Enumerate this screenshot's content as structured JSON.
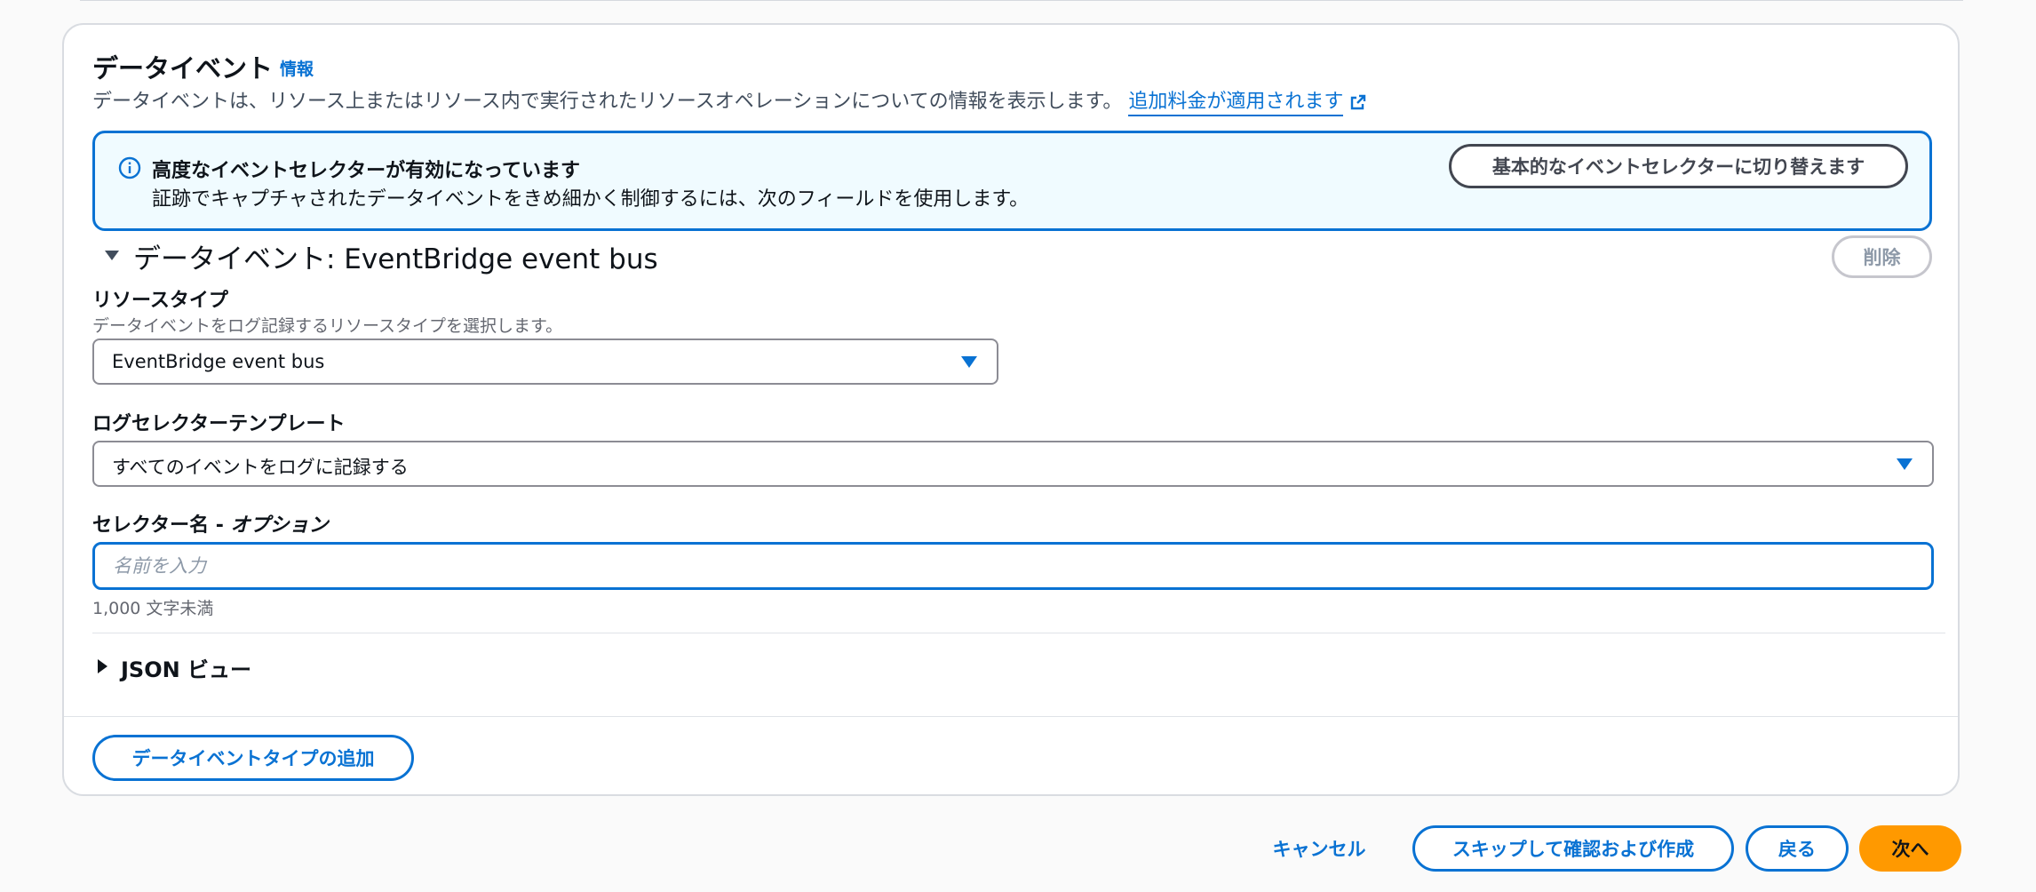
{
  "header": {
    "title": "データイベント",
    "info": "情報",
    "description": "データイベントは、リソース上またはリソース内で実行されたリソースオペレーションについての情報を表示します。",
    "link": "追加料金が適用されます"
  },
  "alert": {
    "title": "高度なイベントセレクターが有効になっています",
    "body": "証跡でキャプチャされたデータイベントをきめ細かく制御するには、次のフィールドを使用します。",
    "button": "基本的なイベントセレクターに切り替えます"
  },
  "section": {
    "title": "データイベント: EventBridge event bus",
    "delete": "削除"
  },
  "resource_type": {
    "label": "リソースタイプ",
    "description": "データイベントをログ記録するリソースタイプを選択します。",
    "value": "EventBridge event bus"
  },
  "template": {
    "label": "ログセレクターテンプレート",
    "value": "すべてのイベントをログに記録する"
  },
  "selector_name": {
    "label": "セレクター名 - ",
    "label_optional": "オプション",
    "placeholder": "名前を入力",
    "value": "",
    "hint": "1,000 文字未満"
  },
  "json_view": {
    "label": "JSON ビュー"
  },
  "add_button": "データイベントタイプの追加",
  "footer": {
    "cancel": "キャンセル",
    "skip": "スキップして確認および作成",
    "back": "戻る",
    "next": "次へ"
  }
}
